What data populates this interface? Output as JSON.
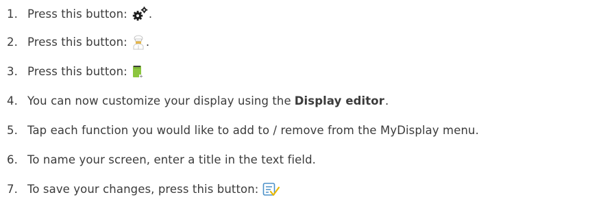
{
  "steps": [
    {
      "number": "1.",
      "text": "Press this button:",
      "icon": "settings-gears-icon",
      "suffix": "."
    },
    {
      "number": "2.",
      "text": "Press this button:",
      "icon": "chef-icon",
      "suffix": "."
    },
    {
      "number": "3.",
      "text": "Press this button:",
      "icon": "notepad-add-icon",
      "suffix": ""
    },
    {
      "number": "4.",
      "text": "You can now customize your display using the",
      "bold": "Display editor",
      "suffix": "."
    },
    {
      "number": "5.",
      "text": "Tap each function you would like to add to / remove from the MyDisplay menu."
    },
    {
      "number": "6.",
      "text": "To name your screen, enter a title in the text field."
    },
    {
      "number": "7.",
      "text": "To save your changes, press this button:",
      "icon": "save-checklist-icon"
    }
  ],
  "colors": {
    "text": "#3b3b3b",
    "chef_gold": "#e8b84a",
    "notepad_green": "#8cc63f",
    "save_blue": "#4a90c8",
    "check_yellow": "#e8b800"
  }
}
